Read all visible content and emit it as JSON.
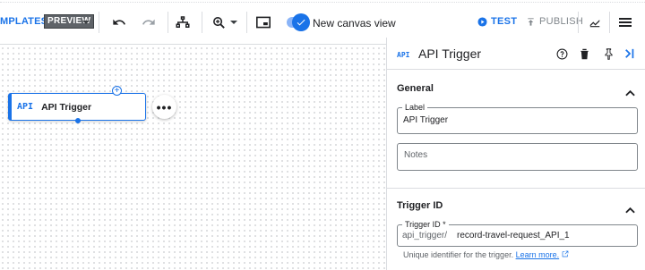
{
  "toolbar": {
    "templates_label": "MPLATES",
    "preview_label": "PREVIEW",
    "canvas_toggle_label": "New canvas view",
    "test_label": "TEST",
    "publish_label": "PUBLISH",
    "canvas_toggle_on": true
  },
  "node": {
    "icon_text": "API",
    "title": "API Trigger",
    "more_label": "•••"
  },
  "panel": {
    "icon_text": "API",
    "title": "API Trigger",
    "general": {
      "section_title": "General",
      "label_field": {
        "label": "Label",
        "value": "API Trigger"
      },
      "notes_field": {
        "placeholder": "Notes"
      }
    },
    "trigger": {
      "section_title": "Trigger ID",
      "id_field": {
        "label": "Trigger ID *",
        "prefix": "api_trigger/",
        "value": "record-travel-request_API_1"
      },
      "hint": "Unique identifier for the trigger.",
      "learn_more": "Learn more."
    }
  },
  "colors": {
    "accent": "#1a73e8",
    "text": "#202124",
    "muted": "#5f6368",
    "border": "#dadce0"
  }
}
